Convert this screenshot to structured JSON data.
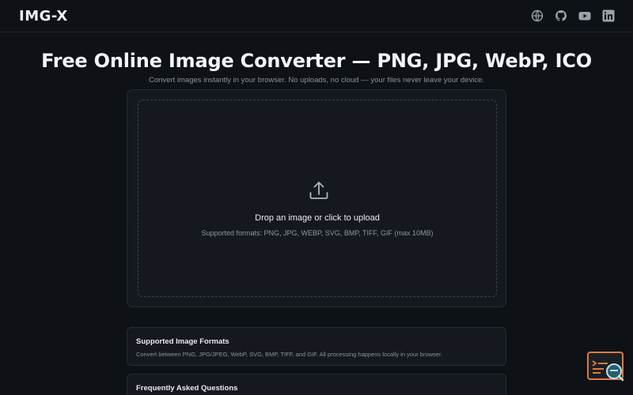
{
  "brand": {
    "logo_text": "IMG-X"
  },
  "social": [
    {
      "icon": "globe-icon"
    },
    {
      "icon": "github-icon"
    },
    {
      "icon": "youtube-icon"
    },
    {
      "icon": "linkedin-icon"
    }
  ],
  "hero": {
    "title": "Free Online Image Converter — PNG, JPG, WebP, ICO",
    "subtitle": "Convert images instantly in your browser. No uploads, no cloud — your files never leave your device."
  },
  "upload": {
    "icon": "upload-icon",
    "title": "Drop an image or click to upload",
    "formats": "Supported formats: PNG, JPG, WEBP, SVG, BMP, TIFF, GIF (max 10MB)"
  },
  "sections": {
    "formats": {
      "title": "Supported Image Formats",
      "text": "Convert between PNG, JPG/JPEG, WebP, SVG, BMP, TIFF, and GIF. All processing happens locally in your browser."
    },
    "faq": {
      "title": "Frequently Asked Questions"
    }
  },
  "colors": {
    "background": "#0e1116",
    "card": "#15191f",
    "accent_widget": "#e07a3a"
  }
}
